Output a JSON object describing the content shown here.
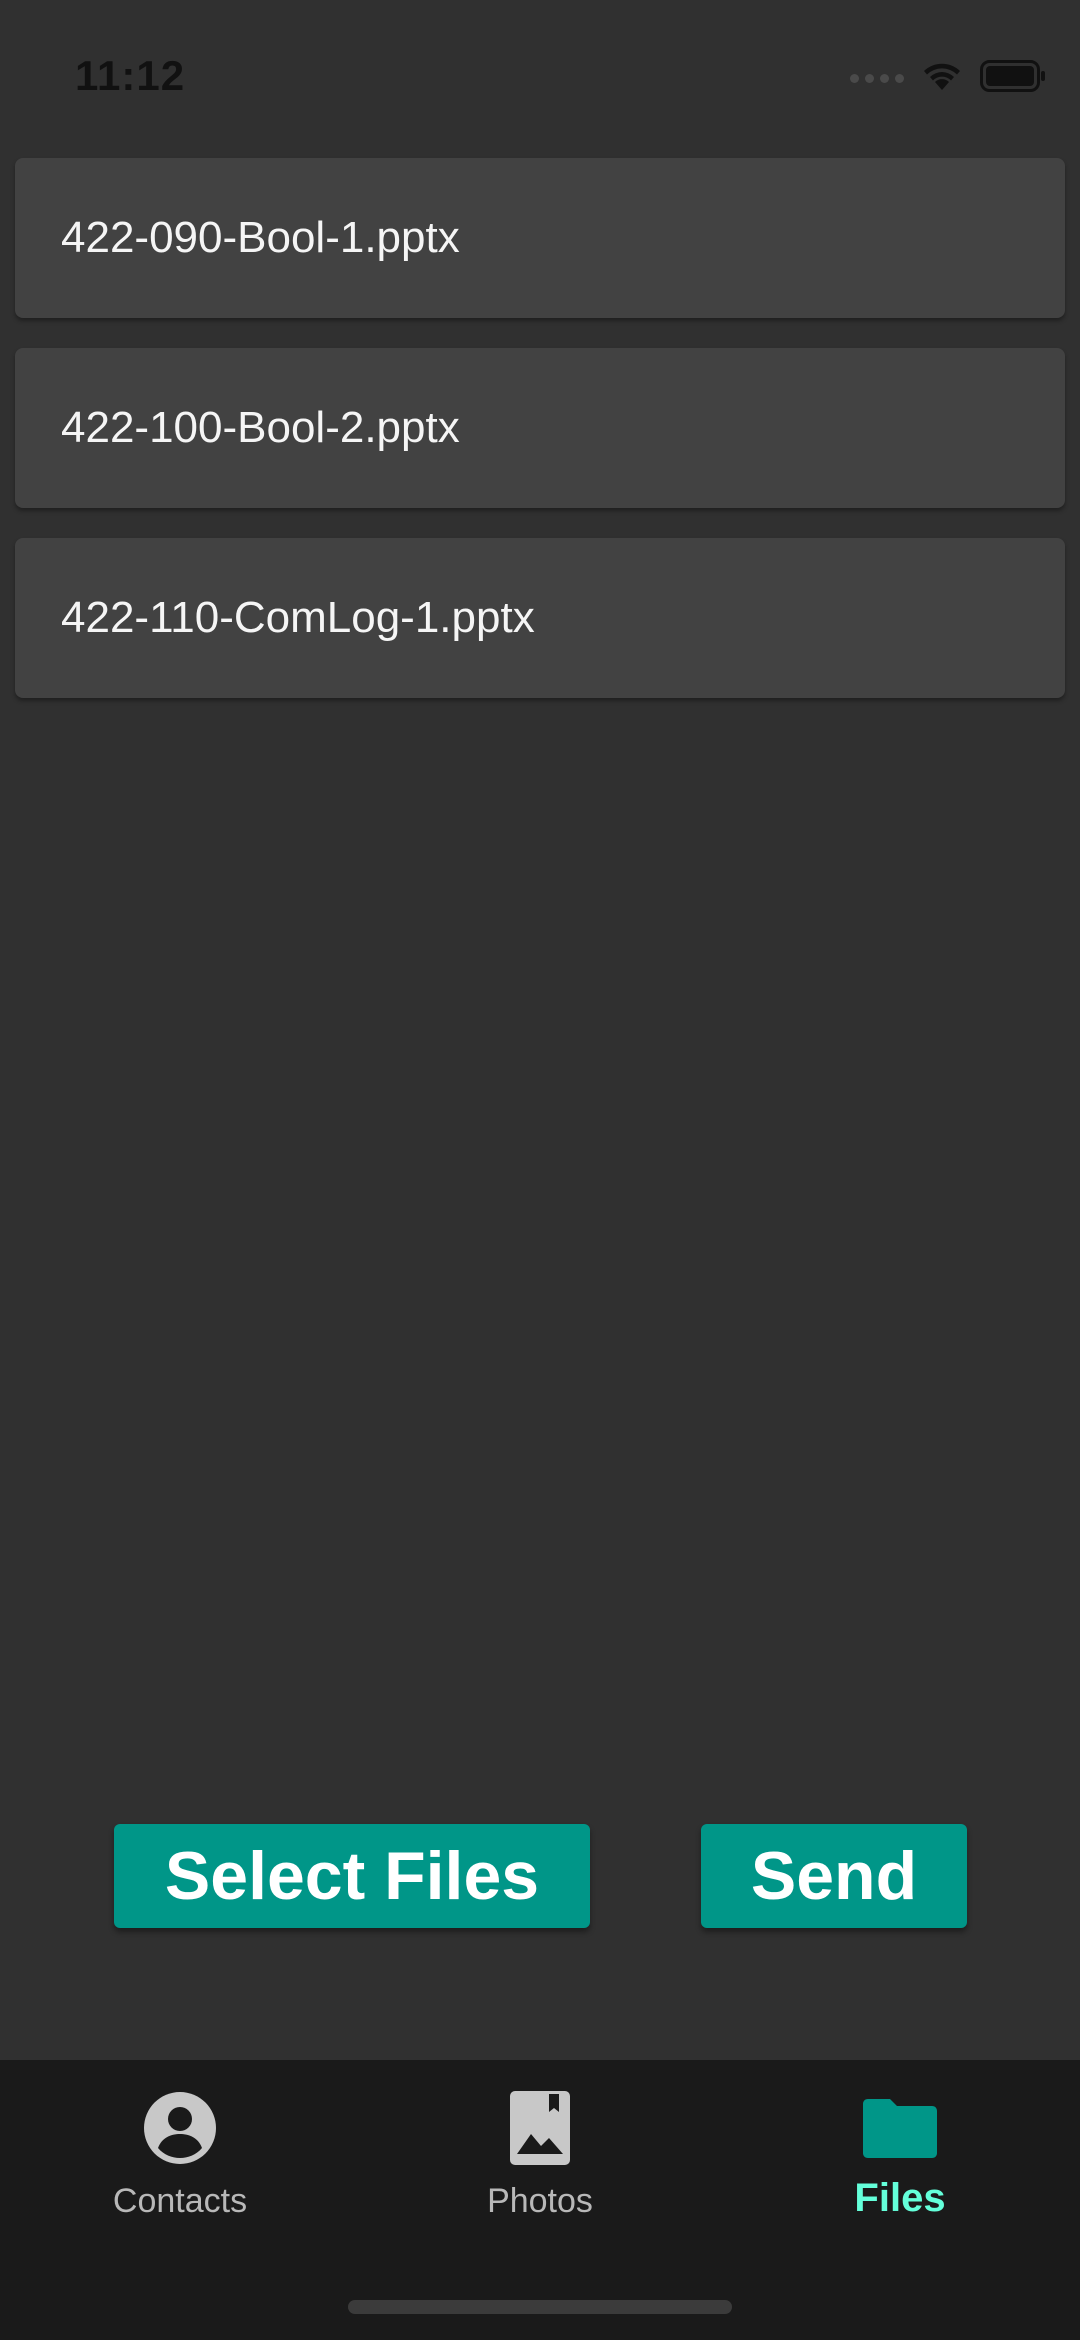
{
  "status_bar": {
    "time": "11:12"
  },
  "files": [
    {
      "name": "422-090-Bool-1.pptx"
    },
    {
      "name": "422-100-Bool-2.pptx"
    },
    {
      "name": "422-110-ComLog-1.pptx"
    }
  ],
  "actions": {
    "select_label": "Select Files",
    "send_label": "Send"
  },
  "bottom_nav": {
    "items": [
      {
        "label": "Contacts",
        "icon": "account-circle-icon"
      },
      {
        "label": "Photos",
        "icon": "image-icon"
      },
      {
        "label": "Files",
        "icon": "folder-icon",
        "active": true
      }
    ]
  },
  "colors": {
    "background": "#303030",
    "card": "#424242",
    "accent": "#009688",
    "active_nav": "#64ffda",
    "nav_background": "#1a1a1a"
  }
}
